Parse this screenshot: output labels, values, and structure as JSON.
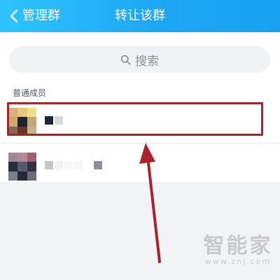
{
  "header": {
    "back_label": "管理群",
    "title": "转让该群"
  },
  "search": {
    "placeholder": "搜索"
  },
  "section": {
    "label": "普通成员"
  },
  "members": [
    {
      "avatar_colors": [
        "#d8b27a",
        "#e6c97d",
        "#efe08c",
        "#cfa774",
        "#1f2430",
        "#c9a571",
        "#7f6a55",
        "#6b3526",
        "#c4b68a"
      ],
      "name_colors": [
        "#1f2637",
        "#d9d9de"
      ],
      "selected": true
    },
    {
      "avatar_colors": [
        "#9c8a95",
        "#b38a97",
        "#a65e74",
        "#2b2e3a",
        "#555a6d",
        "#2f3343",
        "#7b7d86",
        "#26283a",
        "#6f6a73"
      ],
      "name_colors": [
        "#c6c6cc",
        "#f3f3f3",
        "#f7f7f7",
        "#f7f7f7",
        "#ffffff",
        "#8d8f95"
      ],
      "selected": false
    }
  ],
  "colors": {
    "header_start": "#2ec3ff",
    "header_end": "#18a0f2",
    "highlight": "#a8242a",
    "arrow": "#a8242a"
  },
  "watermark": {
    "main": "智能家",
    "url": "www.znj.com"
  }
}
